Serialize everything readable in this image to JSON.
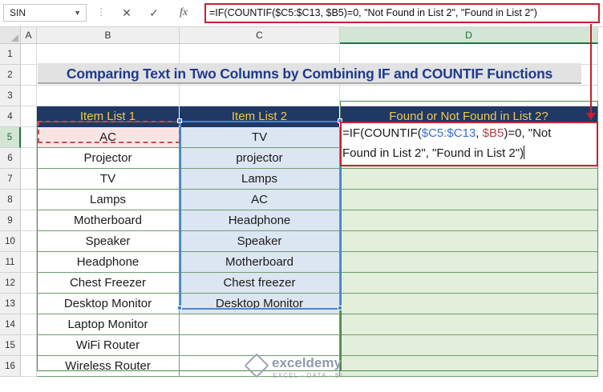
{
  "formula_bar": {
    "name_box": "SIN",
    "cancel_icon": "✕",
    "enter_icon": "✓",
    "fx_label": "fx",
    "formula": "=IF(COUNTIF($C5:$C13, $B5)=0, \"Not Found in List 2\", \"Found in List 2\")"
  },
  "columns": [
    "A",
    "B",
    "C",
    "D"
  ],
  "rows": [
    "1",
    "2",
    "3",
    "4",
    "5",
    "6",
    "7",
    "8",
    "9",
    "10",
    "11",
    "12",
    "13",
    "14",
    "15",
    "16"
  ],
  "title": "Comparing Text in Two Columns by Combining IF and COUNTIF Functions",
  "table": {
    "headers": [
      "Item List 1",
      "Item List 2",
      "Found or Not Found in List 2?"
    ],
    "list1": [
      "AC",
      "Projector",
      "TV",
      "Lamps",
      "Motherboard",
      "Speaker",
      "Headphone",
      "Chest Freezer",
      "Desktop Monitor",
      "Laptop Monitor",
      "WiFi Router",
      "Wireless Router"
    ],
    "list2": [
      "TV",
      "projector",
      "Lamps",
      "AC",
      "Headphone",
      "Speaker",
      "Motherboard",
      "Chest freezer",
      "Desktop Monitor"
    ]
  },
  "editing_cell": {
    "p1": "=IF(COUNTIF(",
    "ref1": "$C5:$C13",
    "p2": ", ",
    "ref2": "$B5",
    "p3": ")=0, \"Not",
    "line2": "Found in List 2\", \"Found in List 2\")"
  },
  "watermark": {
    "title": "exceldemy",
    "subtitle": "EXCEL · DATA · BI"
  },
  "colors": {
    "header_bg": "#203864",
    "header_text": "#f2c94c",
    "list1_first_fill": "#f9e4e4",
    "list2_fill": "#dce6f2",
    "result_fill": "#e2efda",
    "title_text": "#1f3a8c",
    "callout": "#c8202a"
  }
}
